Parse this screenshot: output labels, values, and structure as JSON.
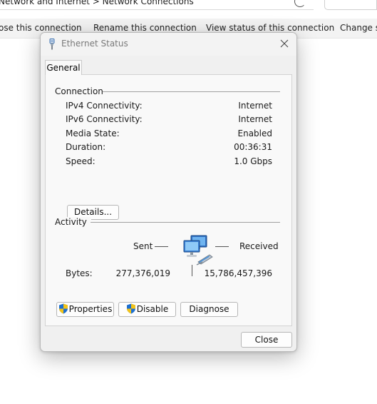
{
  "background": {
    "breadcrumb": "Network and Internet  >  Network Connections",
    "commands": [
      "ose this connection",
      "Rename this connection",
      "View status of this connection",
      "Change se"
    ]
  },
  "dialog": {
    "title": "Ethernet Status",
    "tab": "General",
    "connection": {
      "heading": "Connection",
      "rows": [
        {
          "label": "IPv4 Connectivity:",
          "value": "Internet"
        },
        {
          "label": "IPv6 Connectivity:",
          "value": "Internet"
        },
        {
          "label": "Media State:",
          "value": "Enabled"
        },
        {
          "label": "Duration:",
          "value": "00:36:31"
        },
        {
          "label": "Speed:",
          "value": "1.0 Gbps"
        }
      ],
      "details_button": "Details..."
    },
    "activity": {
      "heading": "Activity",
      "sent_label": "Sent",
      "received_label": "Received",
      "bytes_label": "Bytes:",
      "bytes_sent": "277,376,019",
      "bytes_received": "15,786,457,396"
    },
    "buttons": {
      "properties": "Properties",
      "disable": "Disable",
      "diagnose": "Diagnose",
      "close": "Close"
    }
  },
  "colors": {
    "dialog_bg": "#f0f0f0",
    "panel_bg": "#f9f9f9",
    "shield_blue": "#1c6fd1",
    "shield_yellow": "#f2c318"
  },
  "icons": [
    "ethernet-plug-icon",
    "close-icon",
    "uac-shield-icon",
    "network-computers-icon"
  ]
}
